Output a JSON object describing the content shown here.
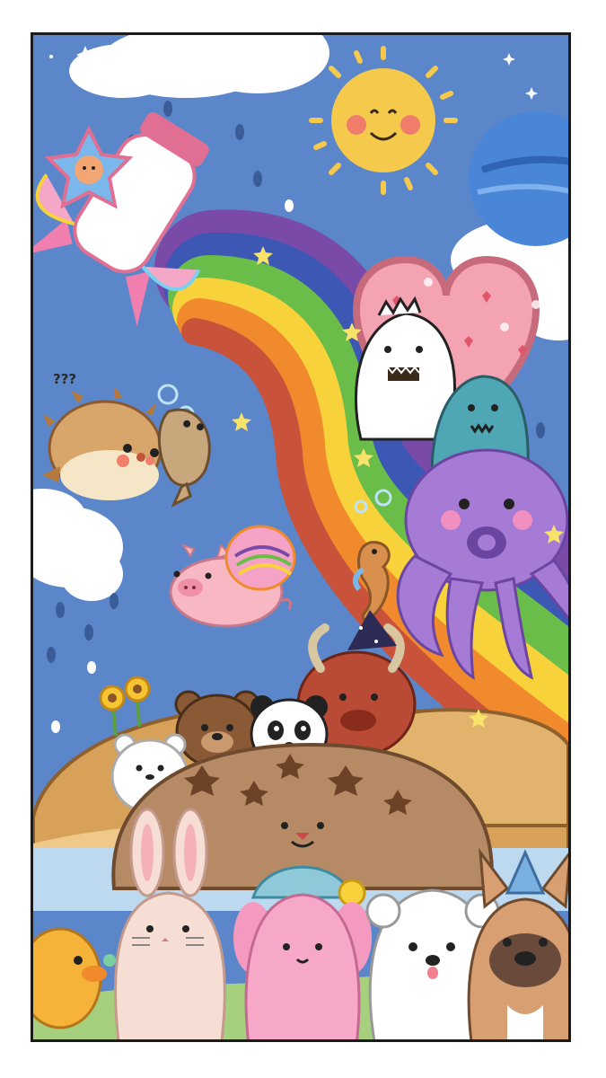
{
  "illustration": {
    "palette": {
      "sky": "#5b86c9",
      "sun": "#f5c94c",
      "cloud": "#ffffff",
      "rainbow": [
        "#c9533a",
        "#f08a2c",
        "#f7d23a",
        "#6bbd4a",
        "#3c57b4",
        "#7a4aa8"
      ],
      "heart": "#f4a3b3",
      "octopus": "#a67bd6",
      "pig": "#f7b8c4",
      "grass": "#a7d07e",
      "bread": "#d8a15a"
    },
    "annotations": {
      "puffer_question_marks": "???"
    },
    "characters": [
      "sun",
      "planet",
      "rocket-cat",
      "puffer-fish",
      "flatfish",
      "flying-pig",
      "heart-sign",
      "white-dinosaur",
      "teal-dinosaur",
      "purple-octopus",
      "seahorse",
      "red-yak",
      "brown-bear",
      "panda",
      "white-bear",
      "sunflowers",
      "cookie-dog",
      "bunny",
      "pink-puppy",
      "white-poodle",
      "french-bulldog",
      "yellow-duck"
    ]
  }
}
